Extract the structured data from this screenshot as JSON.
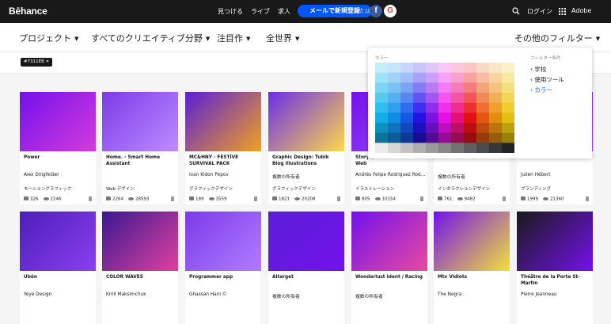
{
  "header": {
    "logo": "Bēhance",
    "nav": [
      "見つける",
      "ライブ",
      "求人"
    ],
    "signup": "メールで新規登録",
    "or": "または",
    "facebook": "f",
    "google": "G",
    "login": "ログイン",
    "adobe": "Adobe"
  },
  "filters": {
    "projects": "プロジェクト",
    "creative_fields": "すべてのクリエイティブ分野",
    "featured": "注目作",
    "world": "全世界",
    "more": "その他のフィルター"
  },
  "active_tag": "#7311EB  ✕",
  "filter_panel": {
    "color_label": "カラー",
    "conditions_label": "フィルター条件",
    "items": [
      {
        "label": "学校",
        "active": false
      },
      {
        "label": "使用ツール",
        "active": false
      },
      {
        "label": "カラー",
        "active": true
      }
    ]
  },
  "cards_row1": [
    {
      "title": "Power",
      "author": "Alex Dingfelder",
      "field": "モーショングラフィック",
      "likes": "326",
      "views": "2246",
      "colors": [
        "#7311eb",
        "#d53bdc"
      ]
    },
    {
      "title": "Home. - Smart Home Assistant",
      "author": "",
      "field": "Web デザイン",
      "likes": "2264",
      "views": "28593",
      "colors": [
        "#7b3be8",
        "#c08cff"
      ]
    },
    {
      "title": "MC&HNY - FESTIVE SURVIVAL PACK",
      "author": "Ivan Kidon Popov",
      "field": "グラフィックデザイン",
      "likes": "189",
      "views": "3559",
      "colors": [
        "#5a1fd6",
        "#f0a020"
      ]
    },
    {
      "title": "Graphic Design: Tubik Blog Illustrations",
      "author": "複数の所有者",
      "field": "グラフィックデザイン",
      "likes": "1821",
      "views": "20208",
      "colors": [
        "#6a2ee8",
        "#ffd84a"
      ]
    },
    {
      "title": "Story // Illustration and Web",
      "author": "Andrés Felipe Rodriguez Rod...",
      "field": "イラストレーション",
      "likes": "805",
      "views": "10154",
      "colors": [
        "#7311eb",
        "#a04cf7"
      ]
    },
    {
      "title": "",
      "author": "複数の所有者",
      "field": "インタラクションデザイン",
      "likes": "761",
      "views": "9482",
      "colors": [
        "#7311eb",
        "#5a0fd0"
      ]
    },
    {
      "title": "",
      "author": "Julien Hébert",
      "field": "ブランディング",
      "likes": "1999",
      "views": "21360",
      "colors": [
        "#7311eb",
        "#9a4bff"
      ]
    }
  ],
  "cards_row2": [
    {
      "title": "Ubön",
      "author": "Yeye Design",
      "colors": [
        "#4c1fb8",
        "#8c3ff0"
      ]
    },
    {
      "title": "COLOR WAVES",
      "author": "Kirill Maksimchuk",
      "colors": [
        "#3a1890",
        "#e040a0"
      ]
    },
    {
      "title": "Programmer app",
      "author": "Ghassan Hani ©",
      "colors": [
        "#7b3be8",
        "#b27cff"
      ]
    },
    {
      "title": "Aitarget",
      "author": "複数の所有者",
      "colors": [
        "#5a1fd6",
        "#7311eb"
      ]
    },
    {
      "title": "Wonderlust Ident / Racing",
      "author": "複数の所有者",
      "colors": [
        "#7311eb",
        "#e84aa0"
      ]
    },
    {
      "title": "Mtv Vidiots",
      "author": "The Negra .",
      "colors": [
        "#7311eb",
        "#f2e13a"
      ]
    },
    {
      "title": "Théâtre de la Porte St-Martin",
      "author": "Pierre Jeanneau",
      "colors": [
        "#1a1a1a",
        "#7311eb"
      ]
    }
  ]
}
